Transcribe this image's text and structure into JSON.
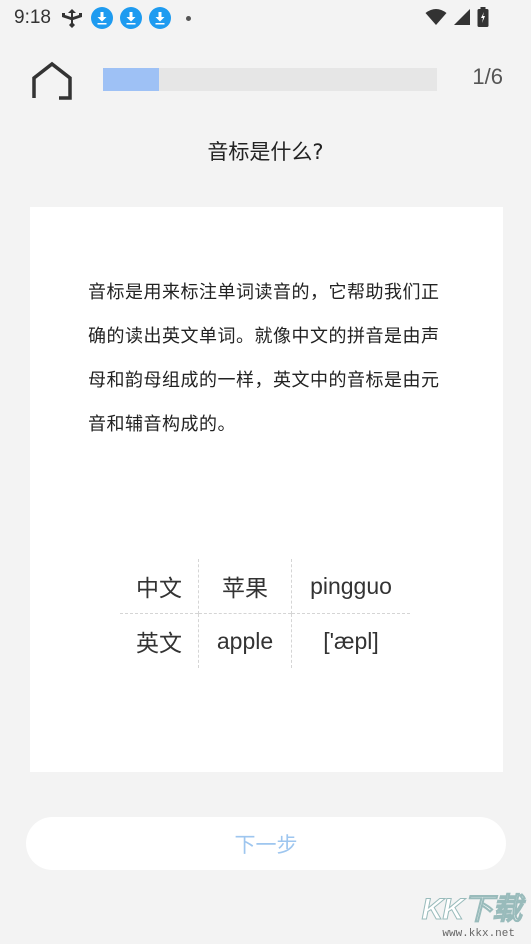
{
  "status_bar": {
    "time": "9:18",
    "icons_left": [
      "usb-icon",
      "download-icon",
      "download-icon",
      "download-icon",
      "dot-icon"
    ],
    "icons_right": [
      "wifi-icon",
      "signal-icon",
      "battery-icon"
    ],
    "accent_color": "#1e9bf0"
  },
  "header": {
    "home_icon": "home-icon",
    "progress_fraction": 0.167,
    "progress_text": "1/6",
    "progress_color": "#9ec1f5"
  },
  "question": {
    "title": "音标是什么?"
  },
  "card": {
    "text": "音标是用来标注单词读音的，它帮助我们正确的读出英文单词。就像中文的拼音是由声母和韵母组成的一样，英文中的音标是由元音和辅音构成的。",
    "table": [
      [
        "中文",
        "苹果",
        "pingguo"
      ],
      [
        "英文",
        "apple",
        "['æpl]"
      ]
    ]
  },
  "footer": {
    "next_label": "下一步"
  },
  "watermark": {
    "logo": "KK下载",
    "url": "www.kkx.net"
  }
}
